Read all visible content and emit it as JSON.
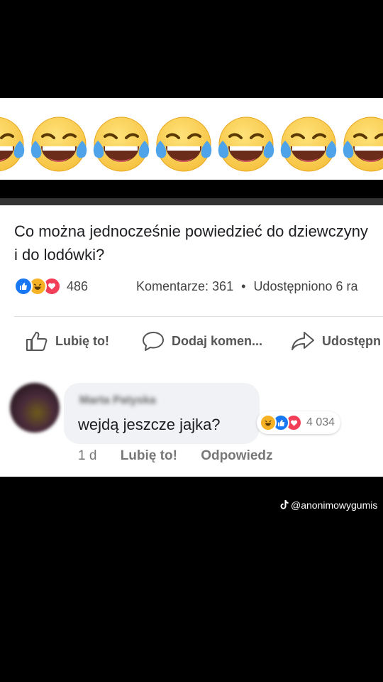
{
  "emoji_band": {
    "emoji_icon": "face-with-tears-of-joy-icon",
    "count": 7
  },
  "post": {
    "text": "Co można jednocześnie powiedzieć do dziewczyny i do lodówki?",
    "reaction_icons": [
      "like-icon",
      "haha-icon",
      "love-icon"
    ],
    "reaction_count": "486",
    "comments_stat": "Komentarze: 361",
    "separator": "•",
    "shares_stat": "Udostępniono 6 ra",
    "actions": {
      "like": "Lubię to!",
      "comment": "Dodaj komen...",
      "share": "Udostępn"
    }
  },
  "comment": {
    "author": "Marta Patyska",
    "text": "wejdą jeszcze jajka?",
    "reaction_count": "4 034",
    "time": "1 d",
    "like": "Lubię to!",
    "reply": "Odpowiedz"
  },
  "watermark": {
    "icon": "tiktok-icon",
    "handle": "@anonimowygumis"
  },
  "colors": {
    "like_blue": "#1877f2",
    "haha_yellow": "#f7b125",
    "love_red": "#f33e58",
    "emoji_yellow": "#f6c342"
  }
}
